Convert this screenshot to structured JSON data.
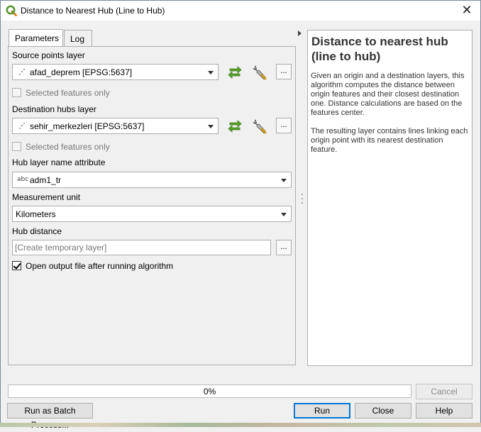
{
  "window": {
    "title": "Distance to Nearest Hub (Line to Hub)",
    "close_glyph": "✕"
  },
  "tabs": [
    {
      "label": "Parameters",
      "active": true
    },
    {
      "label": "Log",
      "active": false
    }
  ],
  "form": {
    "source_label": "Source points layer",
    "source_value": "afad_deprem [EPSG:5637]",
    "source_selected_only": "Selected features only",
    "dest_label": "Destination hubs layer",
    "dest_value": "sehir_merkezleri [EPSG:5637]",
    "dest_selected_only": "Selected features only",
    "hub_attr_label": "Hub layer name attribute",
    "hub_attr_type": "abc",
    "hub_attr_value": "adm1_tr",
    "unit_label": "Measurement unit",
    "unit_value": "Kilometers",
    "hub_distance_label": "Hub distance",
    "hub_distance_placeholder": "[Create temporary layer]",
    "open_output_label": "Open output file after running algorithm",
    "open_output_checked": true,
    "browse_label": "..."
  },
  "help": {
    "title": "Distance to nearest hub (line to hub)",
    "para1": "Given an origin and a destination layers, this algorithm computes the distance between origin features and their closest destination one. Distance calculations are based on the features center.",
    "para2": "The resulting layer contains lines linking each origin point with its nearest destination feature."
  },
  "progress": {
    "value": 0,
    "text": "0%"
  },
  "buttons": {
    "cancel": "Cancel",
    "batch": "Run as Batch Process...",
    "run": "Run",
    "close": "Close",
    "help": "Help"
  },
  "icons": {
    "app": "qgis-logo-icon",
    "iterate": "iterate-green-arrows-icon",
    "settings": "wrench-icon",
    "point_layer": "point-layer-icon"
  },
  "colors": {
    "qgis_green": "#589632",
    "qgis_yellow": "#ee7913",
    "iterate_green": "#5aa02c",
    "progress_fill": "#06b025",
    "default_button_border": "#0078d7"
  }
}
